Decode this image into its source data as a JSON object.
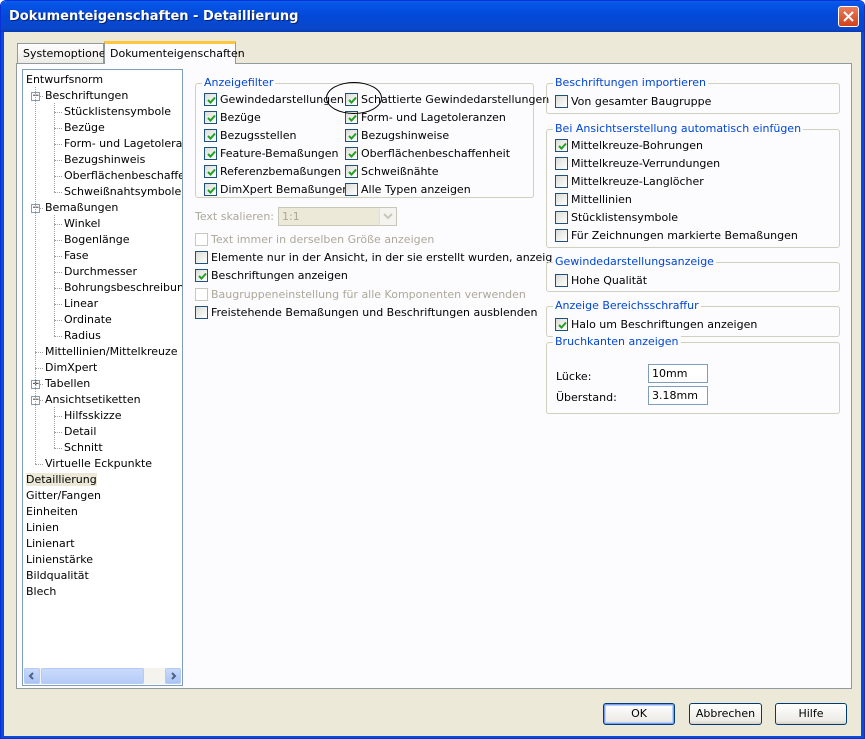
{
  "window": {
    "title": "Dokumenteigenschaften - Detaillierung"
  },
  "tabs": [
    "Systemoptionen",
    "Dokumenteigenschaften"
  ],
  "tree": {
    "items": [
      "Entwurfsnorm",
      "Beschriftungen",
      "Stücklistensymbole",
      "Bezüge",
      "Form- und Lagetoleranzen",
      "Bezugshinweis",
      "Oberflächenbeschaffenheit",
      "Schweißnahtsymbole",
      "Bemaßungen",
      "Winkel",
      "Bogenlänge",
      "Fase",
      "Durchmesser",
      "Bohrungsbeschreibung",
      "Linear",
      "Ordinate",
      "Radius",
      "Mittellinien/Mittelkreuze",
      "DimXpert",
      "Tabellen",
      "Ansichtsetiketten",
      "Hilfsskizze",
      "Detail",
      "Schnitt",
      "Virtuelle Eckpunkte",
      "Detaillierung",
      "Gitter/Fangen",
      "Einheiten",
      "Linien",
      "Linienart",
      "Linienstärke",
      "Bildqualität",
      "Blech"
    ],
    "selected": "Detaillierung"
  },
  "anzeigefilter": {
    "legend": "Anzeigefilter",
    "col1": [
      {
        "label": "Gewindedarstellungen",
        "checked": true
      },
      {
        "label": "Bezüge",
        "checked": true
      },
      {
        "label": "Bezugsstellen",
        "checked": true
      },
      {
        "label": "Feature-Bemaßungen",
        "checked": true
      },
      {
        "label": "Referenzbemaßungen",
        "checked": true
      },
      {
        "label": "DimXpert Bemaßungen",
        "checked": true
      }
    ],
    "col2": [
      {
        "label": "Schattierte Gewindedarstellungen",
        "checked": true
      },
      {
        "label": "Form- und Lagetoleranzen",
        "checked": true
      },
      {
        "label": "Bezugshinweise",
        "checked": true
      },
      {
        "label": "Oberflächenbeschaffenheit",
        "checked": true
      },
      {
        "label": "Schweißnähte",
        "checked": true
      },
      {
        "label": "Alle Typen anzeigen",
        "checked": false
      }
    ]
  },
  "text_scale": {
    "label": "Text skalieren:",
    "value": "1:1"
  },
  "options": [
    {
      "label": "Text immer in derselben Größe anzeigen",
      "checked": false,
      "disabled": true
    },
    {
      "label": "Elemente nur in der Ansicht, in der sie erstellt wurden, anzeigen",
      "checked": false,
      "disabled": false
    },
    {
      "label": "Beschriftungen anzeigen",
      "checked": true,
      "disabled": false
    },
    {
      "label": "Baugruppeneinstellung für alle Komponenten verwenden",
      "checked": false,
      "disabled": true
    },
    {
      "label": "Freistehende Bemaßungen und Beschriftungen ausblenden",
      "checked": false,
      "disabled": false
    }
  ],
  "import_group": {
    "legend": "Beschriftungen importieren",
    "items": [
      {
        "label": "Von gesamter Baugruppe",
        "checked": false
      }
    ]
  },
  "auto_group": {
    "legend": "Bei Ansichtserstellung automatisch einfügen",
    "items": [
      {
        "label": "Mittelkreuze-Bohrungen",
        "checked": true
      },
      {
        "label": "Mittelkreuze-Verrundungen",
        "checked": false
      },
      {
        "label": "Mittelkreuze-Langlöcher",
        "checked": false
      },
      {
        "label": "Mittellinien",
        "checked": false
      },
      {
        "label": "Stücklistensymbole",
        "checked": false
      },
      {
        "label": "Für Zeichnungen markierte Bemaßungen",
        "checked": false
      }
    ]
  },
  "thread_group": {
    "legend": "Gewindedarstellungsanzeige",
    "items": [
      {
        "label": "Hohe Qualität",
        "checked": false
      }
    ]
  },
  "hatch_group": {
    "legend": "Anzeige Bereichsschraffur",
    "items": [
      {
        "label": "Halo um Beschriftungen anzeigen",
        "checked": true
      }
    ]
  },
  "break_group": {
    "legend": "Bruchkanten anzeigen",
    "gap_label": "Lücke:",
    "gap_value": "10mm",
    "overhang_label": "Überstand:",
    "overhang_value": "3.18mm"
  },
  "buttons": {
    "ok": "OK",
    "cancel": "Abbrechen",
    "help": "Hilfe"
  }
}
